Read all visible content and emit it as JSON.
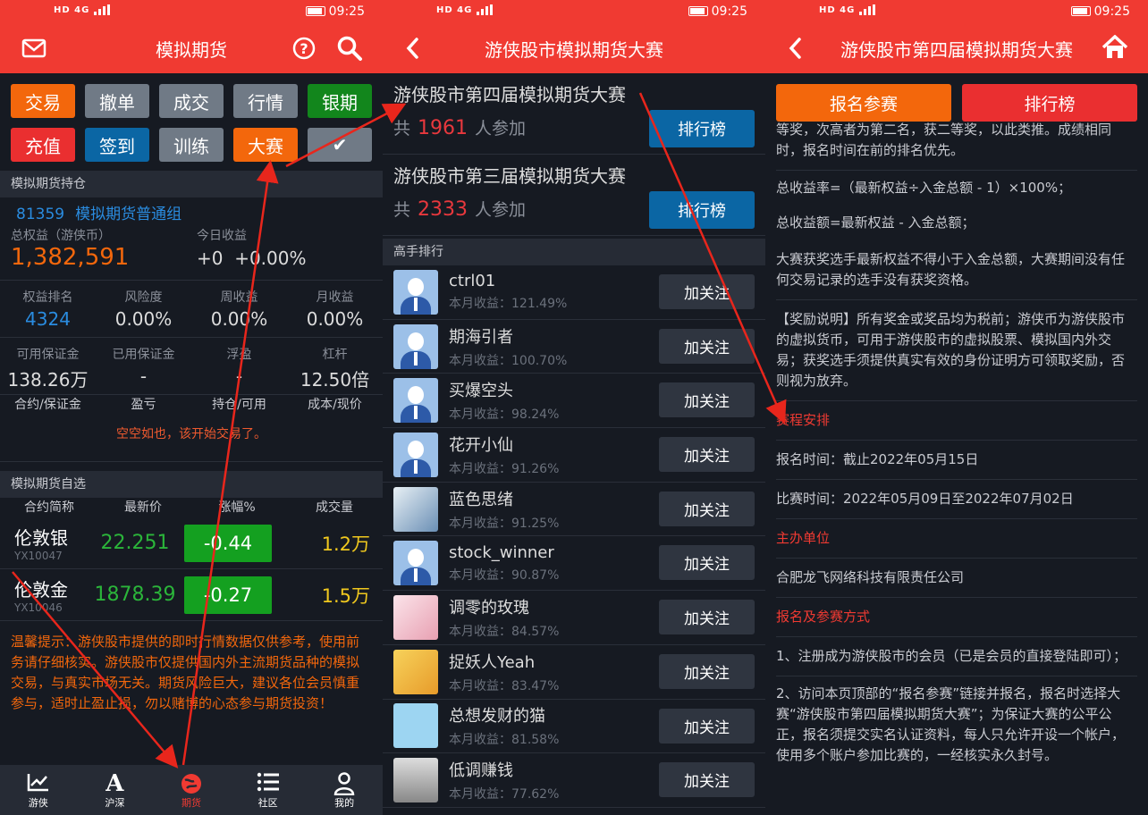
{
  "status": {
    "signal": "HD 4G",
    "time": "09:25"
  },
  "p1": {
    "title": "模拟期货",
    "buttons": [
      "交易",
      "撤单",
      "成交",
      "行情",
      "银期",
      "充值",
      "签到",
      "训练",
      "大赛",
      "✔"
    ],
    "holdings_header": "模拟期货持仓",
    "account_id": "81359",
    "account_group": "模拟期货普通组",
    "total_equity_label": "总权益（游侠币）",
    "total_equity": "1,382,591",
    "today_label": "今日收益",
    "today_value": "+0",
    "today_pct": "+0.00%",
    "stats1": [
      {
        "label": "权益排名",
        "value": "4324"
      },
      {
        "label": "风险度",
        "value": "0.00%"
      },
      {
        "label": "周收益",
        "value": "0.00%"
      },
      {
        "label": "月收益",
        "value": "0.00%"
      }
    ],
    "stats2": [
      {
        "label": "可用保证金",
        "value": "138.26万"
      },
      {
        "label": "已用保证金",
        "value": "-"
      },
      {
        "label": "浮盈",
        "value": "-"
      },
      {
        "label": "杠杆",
        "value": "12.50倍"
      }
    ],
    "pos_headers": [
      "合约/保证金",
      "盈亏",
      "持仓/可用",
      "成本/现价"
    ],
    "empty_msg": "空空如也，该开始交易了。",
    "watch_header": "模拟期货自选",
    "watch_cols": [
      "合约简称",
      "最新价",
      "涨幅%",
      "成交量"
    ],
    "watch": [
      {
        "name": "伦敦银",
        "code": "YX10047",
        "price": "22.251",
        "change": "-0.44",
        "volume": "1.2万"
      },
      {
        "name": "伦敦金",
        "code": "YX10046",
        "price": "1878.39",
        "change": "-0.27",
        "volume": "1.5万"
      }
    ],
    "tip": "温馨提示：游侠股市提供的即时行情数据仅供参考，使用前务请仔细核实。游侠股市仅提供国内外主流期货品种的模拟交易，与真实市场无关。期货风险巨大，建议各位会员慎重参与，适时止盈止损，勿以赌博的心态参与期货投资！",
    "tabs": [
      "游侠",
      "沪深",
      "期货",
      "社区",
      "我的"
    ]
  },
  "p2": {
    "title": "游侠股市模拟期货大赛",
    "contests": [
      {
        "title": "游侠股市第四届模拟期货大赛",
        "prefix": "共",
        "count": "1961",
        "suffix": "人参加",
        "button": "排行榜"
      },
      {
        "title": "游侠股市第三届模拟期货大赛",
        "prefix": "共",
        "count": "2333",
        "suffix": "人参加",
        "button": "排行榜"
      }
    ],
    "rank_header": "高手排行",
    "follow_label": "加关注",
    "players": [
      {
        "name": "ctrl01",
        "gain": "本月收益：121.49%",
        "avatar": "default-avatar-icon"
      },
      {
        "name": "期海引者",
        "gain": "本月收益：100.70%",
        "avatar": "default-avatar-icon"
      },
      {
        "name": "买爆空头",
        "gain": "本月收益：98.24%",
        "avatar": "default-avatar-icon"
      },
      {
        "name": "花开小仙",
        "gain": "本月收益：91.26%",
        "avatar": "default-avatar-icon"
      },
      {
        "name": "蓝色思绪",
        "gain": "本月收益：91.25%",
        "avatar": "photo-avatar"
      },
      {
        "name": "stock_winner",
        "gain": "本月收益：90.87%",
        "avatar": "default-avatar-icon"
      },
      {
        "name": "调零的玫瑰",
        "gain": "本月收益：84.57%",
        "avatar": "pink-avatar"
      },
      {
        "name": "捉妖人Yeah",
        "gain": "本月收益：83.47%",
        "avatar": "yellow-avatar"
      },
      {
        "name": "总想发财的猫",
        "gain": "本月收益：81.58%",
        "avatar": "cartoon-avatar"
      },
      {
        "name": "低调赚钱",
        "gain": "本月收益：77.62%",
        "avatar": "girl-avatar"
      }
    ]
  },
  "p3": {
    "title": "游侠股市第四届模拟期货大赛",
    "btn_signup": "报名参赛",
    "btn_rank": "排行榜",
    "para_top": "等奖，次高者为第二名，获二等奖，以此类推。成绩相同时，报名时间在前的排名优先。",
    "para_rate": "总收益率=（最新权益÷入金总额 - 1）×100%；",
    "para_amount": "总收益额=最新权益 - 入金总额；",
    "para_rule": "大赛获奖选手最新权益不得小于入金总额，大赛期间没有任何交易记录的选手没有获奖资格。",
    "para_prize": "【奖励说明】所有奖金或奖品均为税前；游侠币为游侠股市的虚拟货币，可用于游侠股市的虚拟股票、模拟国内外交易；获奖选手须提供真实有效的身份证明方可领取奖励，否则视为放弃。",
    "h_schedule": "赛程安排",
    "signup_time": "报名时间：截止2022年05月15日",
    "match_time": "比赛时间：2022年05月09日至2022年07月02日",
    "h_host": "主办单位",
    "host": "合肥龙飞网络科技有限责任公司",
    "h_method": "报名及参赛方式",
    "step1": "1、注册成为游侠股市的会员（已是会员的直接登陆即可）；",
    "step2": "2、访问本页顶部的“报名参赛”链接并报名，报名时选择大赛“游侠股市第四届模拟期货大赛”；为保证大赛的公平公正，报名须提交实名认证资料，每人只允许开设一个帐户，使用多个账户参加比赛的，一经核实永久封号。"
  },
  "colors": {
    "brand_red": "#f03a32",
    "orange": "#f3670c",
    "blue": "#0b66a4",
    "green": "#14a020",
    "annotation_arrow": "#e8261c"
  }
}
